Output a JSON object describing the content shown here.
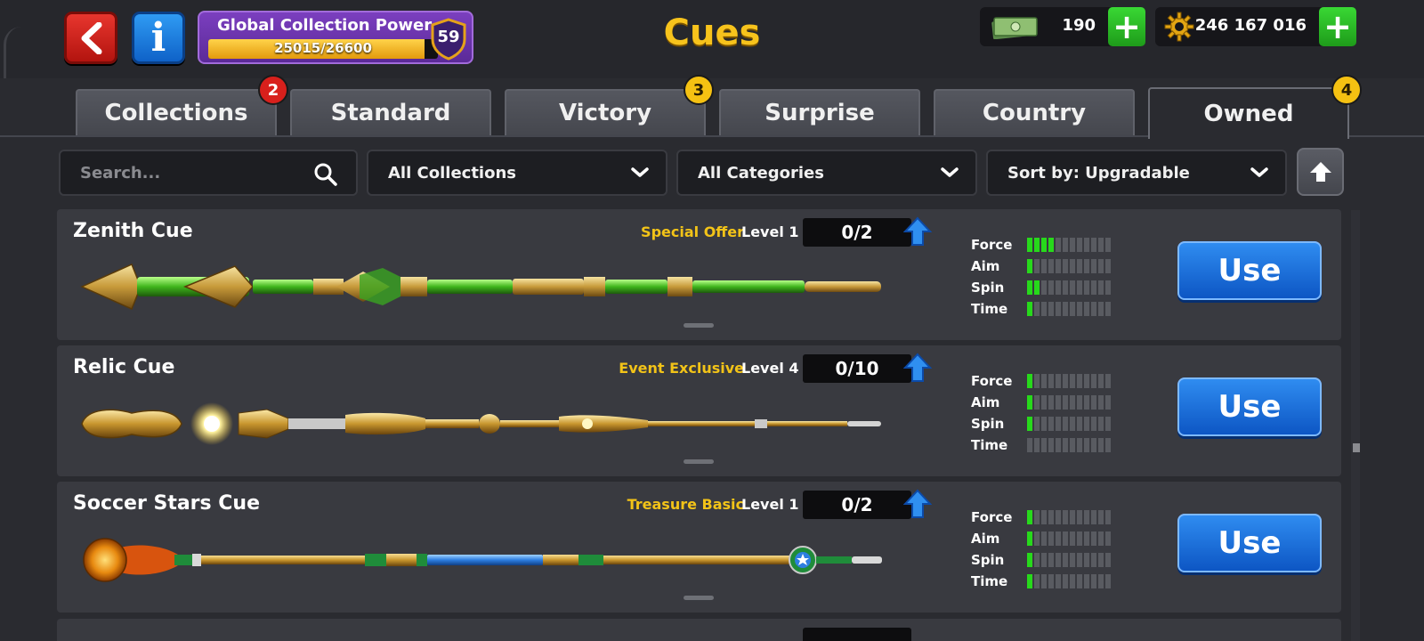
{
  "header": {
    "title": "Cues",
    "global_power": {
      "label": "Global Collection Power",
      "progress_text": "25015/26600",
      "progress_fraction": 0.9404,
      "level": "59"
    },
    "cash": {
      "value": "190",
      "icon": "cash-icon"
    },
    "coins": {
      "value": "246 167 016",
      "icon": "coin-icon"
    }
  },
  "tabs": [
    {
      "label": "Collections",
      "badge": "2",
      "badge_color": "red"
    },
    {
      "label": "Standard",
      "badge": ""
    },
    {
      "label": "Victory",
      "badge": "3",
      "badge_color": "yellow"
    },
    {
      "label": "Surprise",
      "badge": ""
    },
    {
      "label": "Country",
      "badge": ""
    },
    {
      "label": "Owned",
      "badge": "4",
      "badge_color": "yellow",
      "active": true
    }
  ],
  "filters": {
    "search_placeholder": "Search...",
    "collections": "All Collections",
    "categories": "All Categories",
    "sort": "Sort by: Upgradable"
  },
  "stat_labels": [
    "Force",
    "Aim",
    "Spin",
    "Time"
  ],
  "cues": [
    {
      "name": "Zenith Cue",
      "tag": "Special Offer",
      "level": "Level 1",
      "progress": "0/2",
      "stats": {
        "force": 4,
        "aim": 1,
        "spin": 2,
        "time": 1
      },
      "use_label": "Use"
    },
    {
      "name": "Relic Cue",
      "tag": "Event Exclusive",
      "level": "Level 4",
      "progress": "0/10",
      "stats": {
        "force": 1,
        "aim": 1,
        "spin": 1,
        "time": 0
      },
      "use_label": "Use"
    },
    {
      "name": "Soccer Stars Cue",
      "tag": "Treasure Basic",
      "level": "Level 1",
      "progress": "0/2",
      "stats": {
        "force": 1,
        "aim": 1,
        "spin": 1,
        "time": 1
      },
      "use_label": "Use"
    }
  ],
  "colors": {
    "accent_gold": "#f7c31c",
    "tag_yellow": "#f2c318",
    "use_blue": "#1a6fe0",
    "plus_green": "#2bc227",
    "stat_on": "#27d91b"
  }
}
